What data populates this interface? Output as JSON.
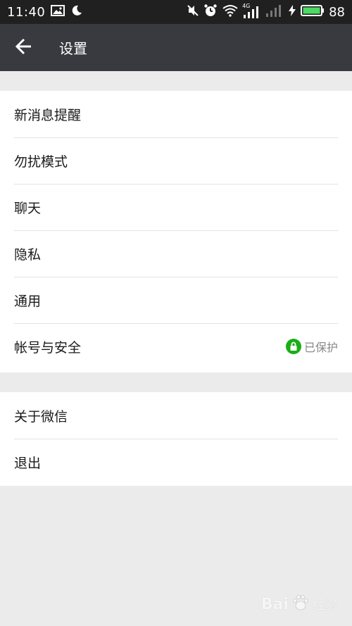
{
  "status_bar": {
    "time": "11:40",
    "network_badge": "4G",
    "battery_level": "88"
  },
  "header": {
    "title": "设置"
  },
  "settings": {
    "group1": [
      {
        "label": "新消息提醒"
      },
      {
        "label": "勿扰模式"
      },
      {
        "label": "聊天"
      },
      {
        "label": "隐私"
      },
      {
        "label": "通用"
      },
      {
        "label": "帐号与安全",
        "status": "已保护"
      }
    ],
    "group2": [
      {
        "label": "关于微信"
      },
      {
        "label": "退出"
      }
    ]
  },
  "watermark": {
    "brand": "Bai",
    "suffix": "经验"
  },
  "colors": {
    "status_bar_bg": "#202020",
    "app_bar_bg": "#393a3f",
    "page_bg": "#ebebeb",
    "protect_green": "#1aad19",
    "battery_green": "#4cd964"
  },
  "icons": {
    "back": "arrow-left-icon",
    "gallery": "image-icon",
    "moon": "moon-icon",
    "mute": "mute-icon",
    "alarm": "alarm-icon",
    "wifi": "wifi-icon",
    "signal": "signal-icon",
    "charging": "charging-icon",
    "battery": "battery-icon",
    "lock": "lock-icon"
  }
}
